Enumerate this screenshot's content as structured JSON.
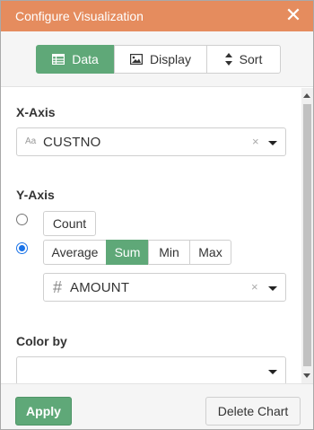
{
  "dialog": {
    "title": "Configure Visualization",
    "close_glyph": "✕"
  },
  "tabs": [
    {
      "label": "Data",
      "icon": "table-icon",
      "active": true
    },
    {
      "label": "Display",
      "icon": "image-icon",
      "active": false
    },
    {
      "label": "Sort",
      "icon": "sort-icon",
      "active": false
    }
  ],
  "x_axis": {
    "label": "X-Axis",
    "field_type_glyph": "Aa",
    "value": "CUSTNO",
    "clear_glyph": "×"
  },
  "y_axis": {
    "label": "Y-Axis",
    "mode_selected": "aggregate",
    "count_label": "Count",
    "aggregations": [
      "Average",
      "Sum",
      "Min",
      "Max"
    ],
    "aggregation_selected": "Sum",
    "field_type_glyph": "#",
    "value": "AMOUNT",
    "clear_glyph": "×"
  },
  "color_by": {
    "label": "Color by",
    "value": ""
  },
  "footer": {
    "apply_label": "Apply",
    "delete_label": "Delete Chart"
  },
  "colors": {
    "titlebar": "#e58c5e",
    "accent_green": "#5fa878",
    "radio_blue": "#1a73e8"
  }
}
